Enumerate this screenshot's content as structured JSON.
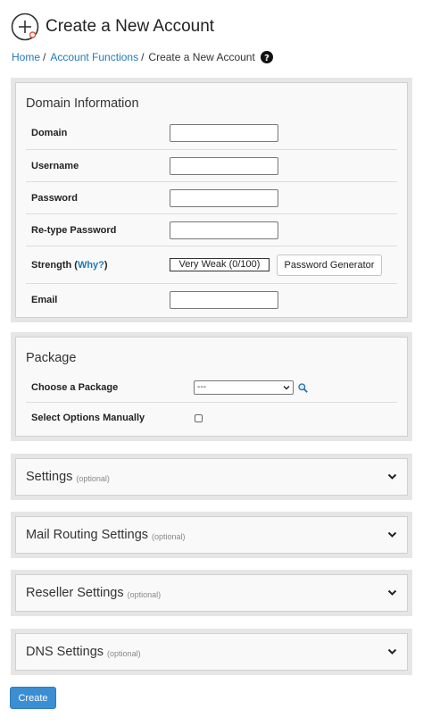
{
  "page": {
    "title": "Create a New Account"
  },
  "breadcrumb": {
    "items": [
      "Home",
      "Account Functions"
    ],
    "current": "Create a New Account"
  },
  "domain_info": {
    "title": "Domain Information",
    "fields": {
      "domain": {
        "label": "Domain",
        "value": ""
      },
      "username": {
        "label": "Username",
        "value": ""
      },
      "password": {
        "label": "Password",
        "value": ""
      },
      "retype": {
        "label": "Re-type Password",
        "value": ""
      },
      "strength": {
        "label_prefix": "Strength (",
        "link": "Why?",
        "label_suffix": ")",
        "meter": "Very Weak (0/100)",
        "generator_button": "Password Generator"
      },
      "email": {
        "label": "Email",
        "value": ""
      }
    }
  },
  "package": {
    "title": "Package",
    "choose_label": "Choose a Package",
    "selected": "---",
    "manual_label": "Select Options Manually",
    "manual_checked": false
  },
  "sections": [
    {
      "title": "Settings",
      "optional": "(optional)"
    },
    {
      "title": "Mail Routing Settings",
      "optional": "(optional)"
    },
    {
      "title": "Reseller Settings",
      "optional": "(optional)"
    },
    {
      "title": "DNS Settings",
      "optional": "(optional)"
    }
  ],
  "create_button": "Create",
  "colors": {
    "link": "#1f7ab8",
    "primary_button": "#3c8ed3",
    "panel_frame": "#e6e6e6"
  }
}
